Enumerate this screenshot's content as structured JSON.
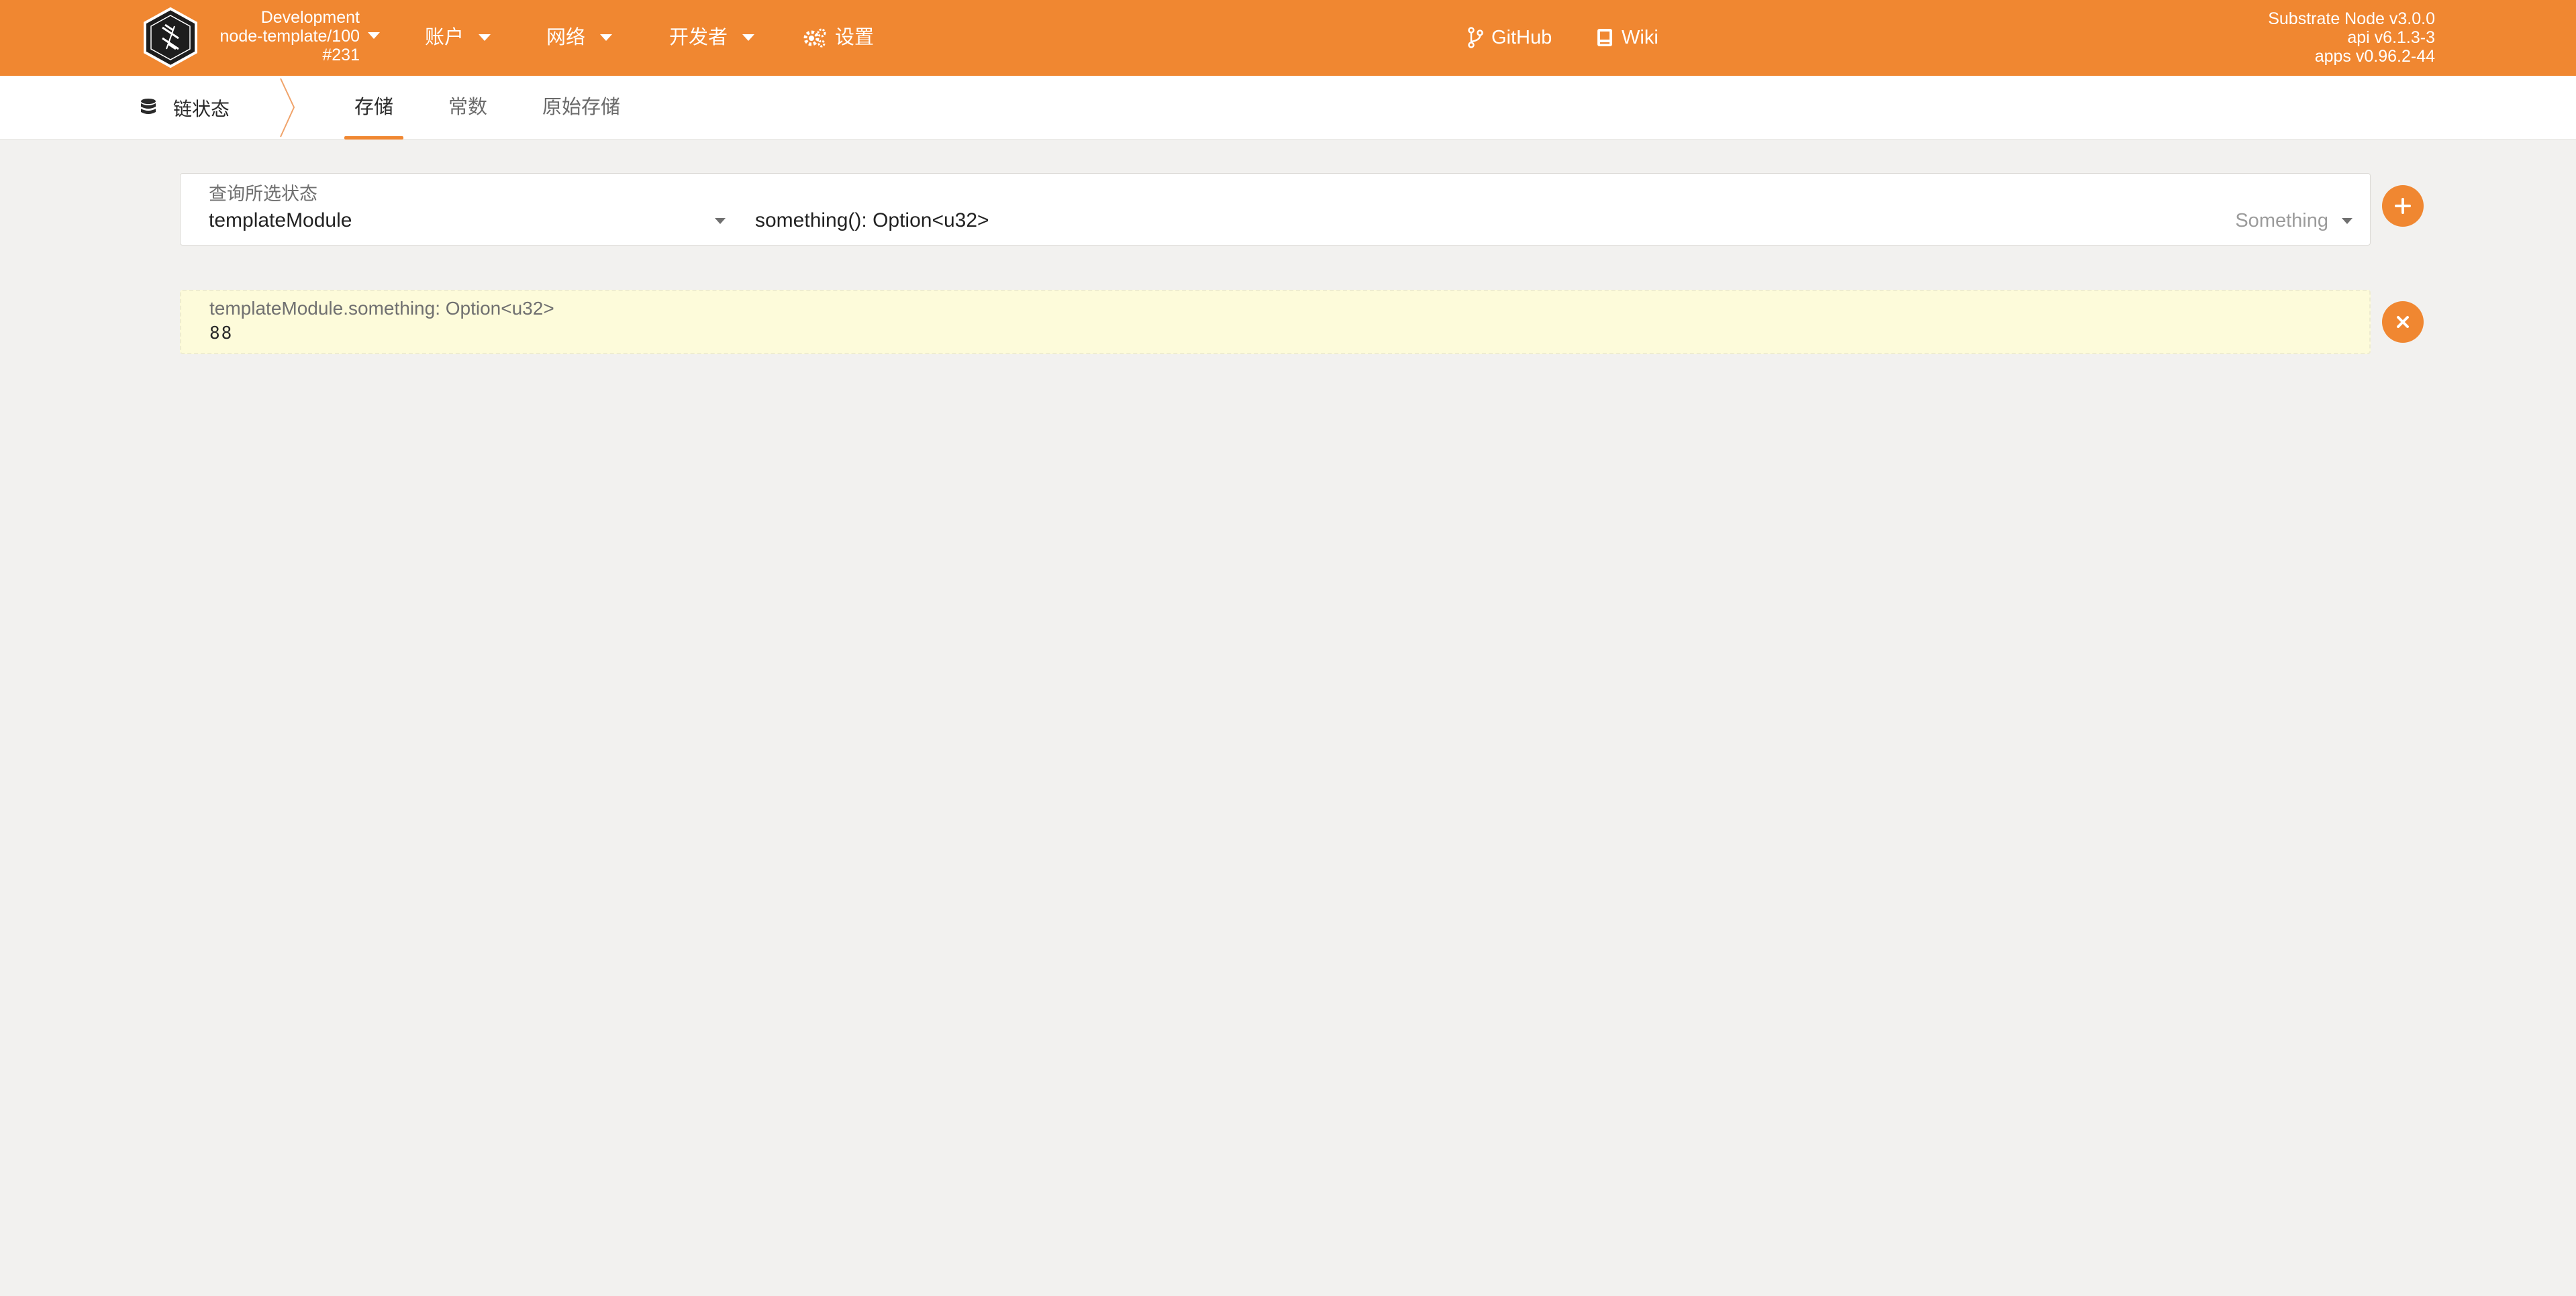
{
  "header": {
    "chain": {
      "name": "Development",
      "runtime": "node-template/100",
      "block": "#231"
    },
    "nav": {
      "accounts": "账户",
      "network": "网络",
      "developer": "开发者",
      "settings": "设置",
      "github": "GitHub",
      "wiki": "Wiki"
    },
    "version": {
      "node": "Substrate Node v3.0.0",
      "api": "api v6.1.3-3",
      "apps": "apps v0.96.2-44"
    }
  },
  "tabs": {
    "section": "链状态",
    "items": [
      "存储",
      "常数",
      "原始存储"
    ],
    "active_index": 0
  },
  "query": {
    "label": "查询所选状态",
    "module": "templateModule",
    "method": "something(): Option<u32>",
    "method_hint": "Something"
  },
  "result": {
    "label": "templateModule.something: Option<u32>",
    "value": "88"
  },
  "colors": {
    "accent": "#f08731",
    "background": "#f2f1ef",
    "result_bg": "#fdfbda"
  },
  "icons": {
    "logo": "substrate-logo-icon",
    "settings": "gears-icon",
    "github": "git-branch-icon",
    "wiki": "book-icon",
    "section": "database-icon",
    "add": "plus-icon",
    "remove": "close-icon"
  }
}
